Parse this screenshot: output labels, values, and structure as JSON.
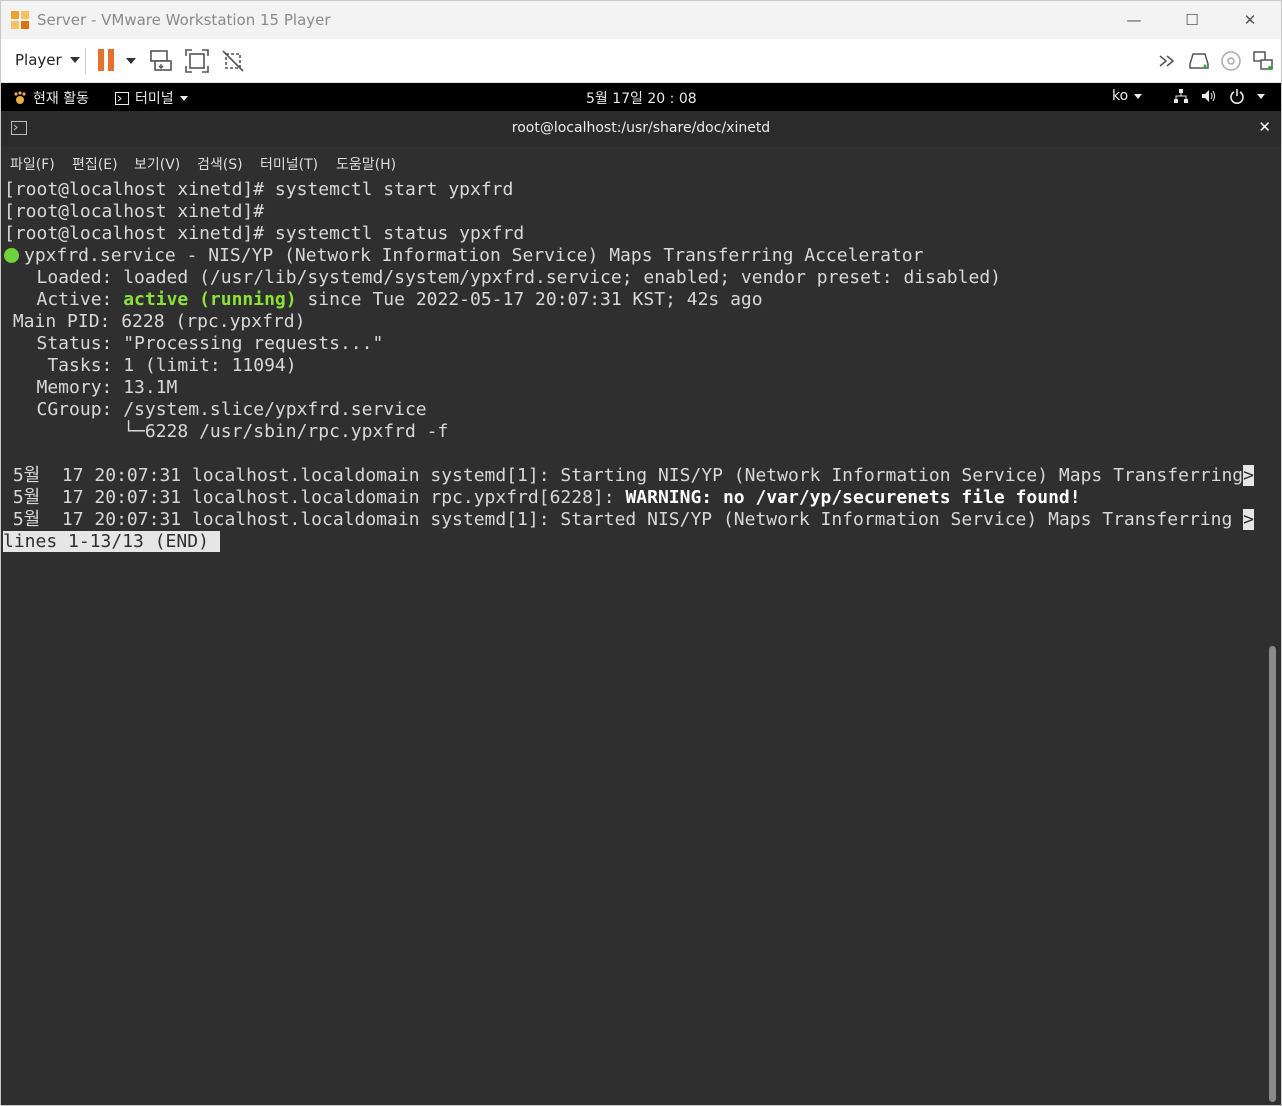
{
  "window": {
    "title": "Server - VMware Workstation 15 Player",
    "minimize_glyph": "—",
    "maximize_glyph": "☐",
    "close_glyph": "✕"
  },
  "toolbar": {
    "player_label": "Player",
    "pause_icon": "pause-icon",
    "right_icons": [
      "fast-forward-icon",
      "hdd-icon",
      "cd-icon",
      "network-icon"
    ]
  },
  "gnome": {
    "activities": "현재 활동",
    "terminal_app": "터미널",
    "clock": "5월 17일  20 : 08",
    "lang": "ko"
  },
  "terminal": {
    "title": "root@localhost:/usr/share/doc/xinetd",
    "close_glyph": "✕",
    "menu": [
      "파일(F)",
      "편집(E)",
      "보기(V)",
      "검색(S)",
      "터미널(T)",
      "도움말(H)"
    ],
    "lines": {
      "l1": "[root@localhost xinetd]# systemctl start ypxfrd",
      "l2": "[root@localhost xinetd]#",
      "l3": "[root@localhost xinetd]# systemctl status ypxfrd",
      "l4": "ypxfrd.service - NIS/YP (Network Information Service) Maps Transferring Accelerator",
      "l5": "   Loaded: loaded (/usr/lib/systemd/system/ypxfrd.service; enabled; vendor preset: disabled)",
      "l6a": "   Active: ",
      "l6b": "active (running)",
      "l6c": " since Tue 2022-05-17 20:07:31 KST; 42s ago",
      "l7": " Main PID: 6228 (rpc.ypxfrd)",
      "l8": "   Status: \"Processing requests...\"",
      "l9": "    Tasks: 1 (limit: 11094)",
      "l10": "   Memory: 13.1M",
      "l11": "   CGroup: /system.slice/ypxfrd.service",
      "l12": "           └─6228 /usr/sbin/rpc.ypxfrd -f",
      "l14": " 5월  17 20:07:31 localhost.localdomain systemd[1]: Starting NIS/YP (Network Information Service) Maps Transferring",
      "l14_more": ">",
      "l15a": " 5월  17 20:07:31 localhost.localdomain rpc.ypxfrd[6228]: ",
      "l15b": "WARNING: no /var/yp/securenets file found!",
      "l16": " 5월  17 20:07:31 localhost.localdomain systemd[1]: Started NIS/YP (Network Information Service) Maps Transferring ",
      "l16_more": ">",
      "pager": "lines 1-13/13 (END)"
    }
  }
}
